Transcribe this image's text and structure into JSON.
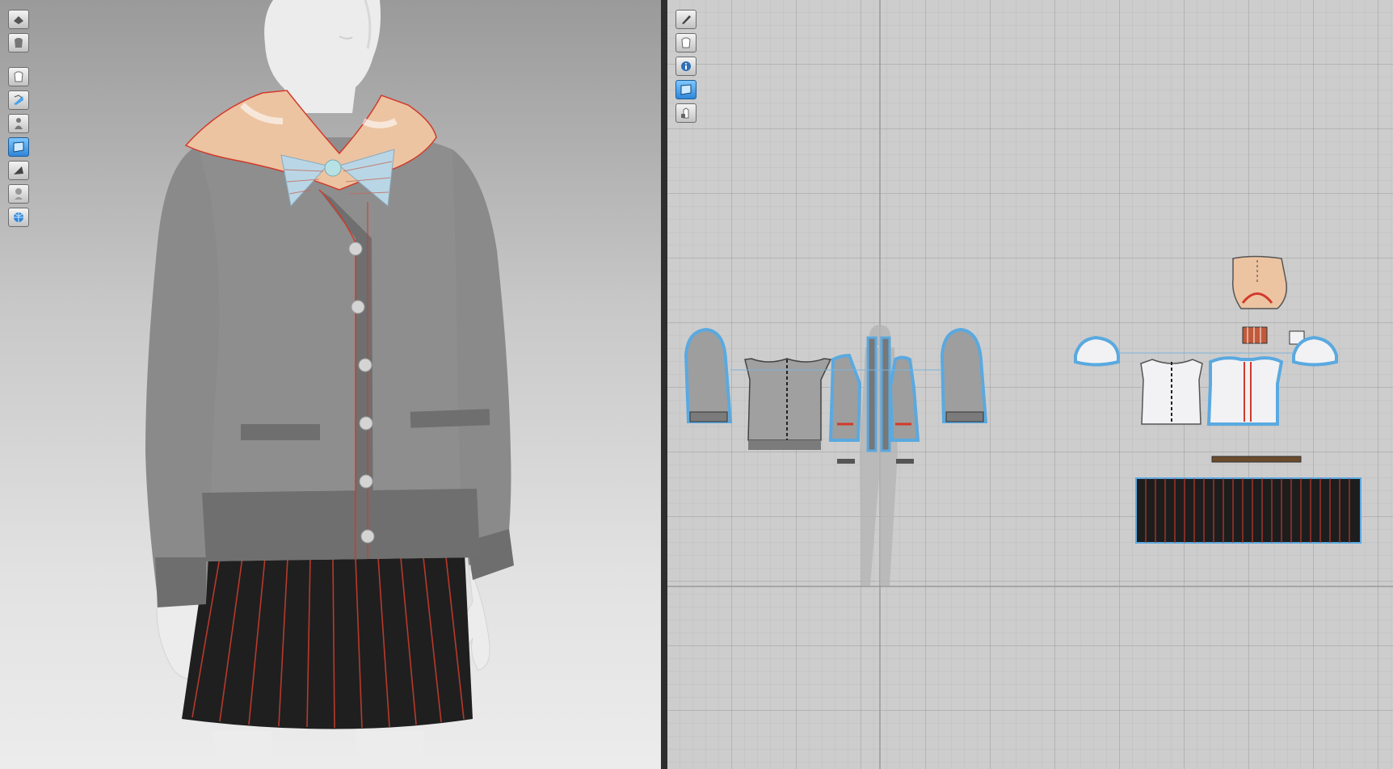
{
  "app": {
    "left_panel": "3d-garment-view",
    "right_panel": "2d-pattern-view"
  },
  "toolbar_3d": {
    "tools": [
      {
        "icon": "render-camera-icon",
        "active": false
      },
      {
        "icon": "garment-texture-icon",
        "active": false
      },
      {
        "icon": "garment-display-icon",
        "active": false
      },
      {
        "icon": "avatar-display-icon",
        "active": false
      },
      {
        "icon": "avatar-pose-icon",
        "active": false
      },
      {
        "icon": "texture-view-icon",
        "active": true
      },
      {
        "icon": "surface-view-icon",
        "active": false
      },
      {
        "icon": "avatar-skin-icon",
        "active": false
      },
      {
        "icon": "environment-globe-icon",
        "active": false
      }
    ]
  },
  "toolbar_2d": {
    "tools": [
      {
        "icon": "pen-edit-icon",
        "active": false
      },
      {
        "icon": "shirt-pattern-icon",
        "active": false
      },
      {
        "icon": "info-icon",
        "active": false
      },
      {
        "icon": "texture-view-icon",
        "active": true
      },
      {
        "icon": "lock-shirt-icon",
        "active": false
      }
    ]
  },
  "colors": {
    "cardigan": "#8f8f8f",
    "cardigan_rib": "#6f6f6f",
    "skirt": "#1d1d1d",
    "seam": "#d23a2a",
    "collar": "#ecc4a2",
    "bow": "#b9d6e6",
    "mannequin": "#e9e9e9",
    "piece_outline": "#5aa9e0",
    "piece_gray": "#9e9e9e",
    "piece_white": "#f2f2f4"
  }
}
